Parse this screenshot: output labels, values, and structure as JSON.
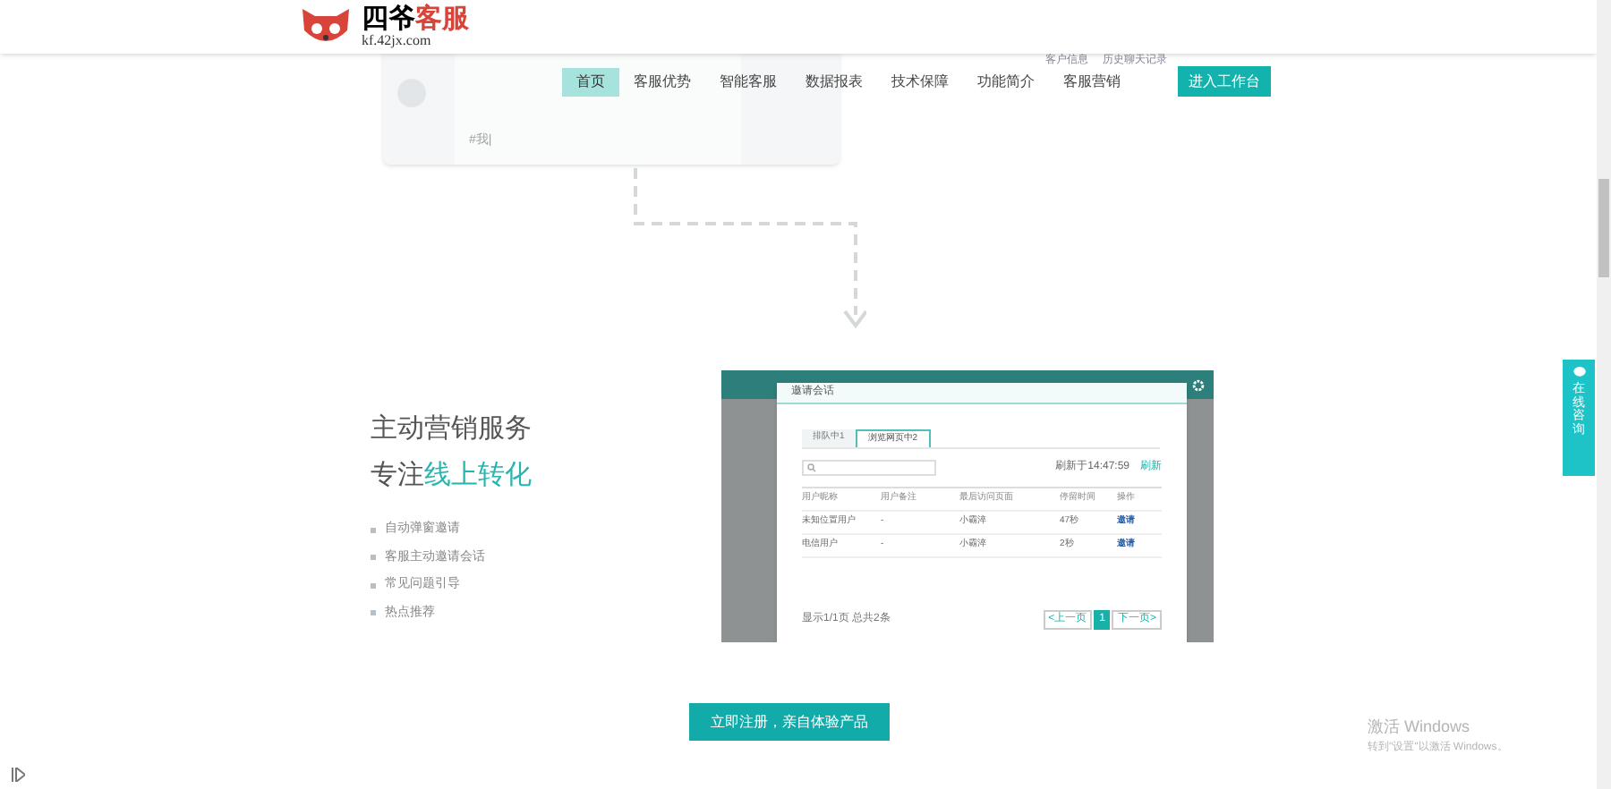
{
  "header": {
    "logo_name": "四爷",
    "logo_accent": "客服",
    "logo_url": "kf.42jx.com"
  },
  "nav": {
    "items": [
      {
        "label": "首页",
        "selected": true
      },
      {
        "label": "客服优势",
        "selected": false
      },
      {
        "label": "智能客服",
        "selected": false
      },
      {
        "label": "数据报表",
        "selected": false
      },
      {
        "label": "技术保障",
        "selected": false
      },
      {
        "label": "功能简介",
        "selected": false
      },
      {
        "label": "客服营销",
        "selected": false
      }
    ],
    "button": "进入工作台"
  },
  "top_mock": {
    "side_items": [
      "客户信息",
      "历史聊天记录"
    ],
    "input_text": "#我|"
  },
  "feature": {
    "title": "主动营销服务",
    "subtitle_prefix": "专注",
    "subtitle_accent": "线上转化",
    "bullets": [
      "自动弹窗邀请",
      "客服主动邀请会话",
      "常见问题引导",
      "热点推荐"
    ]
  },
  "dialog": {
    "title": "邀请会话",
    "tabs": [
      {
        "label": "排队中1",
        "selected": false
      },
      {
        "label": "浏览网页中2",
        "selected": true
      }
    ],
    "refreshed": "刷新于14:47:59",
    "refresh": "刷新",
    "columns": [
      "用户昵称",
      "用户备注",
      "最后访问页面",
      "停留时间",
      "操作"
    ],
    "rows": [
      [
        "未知位置用户",
        "-",
        "小霸淬",
        "47秒",
        "邀请"
      ],
      [
        "电信用户",
        "-",
        "小霸淬",
        "2秒",
        "邀请"
      ]
    ],
    "footer": "显示1/1页 总共2条",
    "pager": [
      "<上一页",
      "1",
      "下一页>"
    ]
  },
  "cta": "立即注册，亲自体验产品",
  "side_tab": "在线咨询",
  "windows": {
    "title": "激活 Windows",
    "text": "转到\"设置\"以激活 Windows。"
  }
}
